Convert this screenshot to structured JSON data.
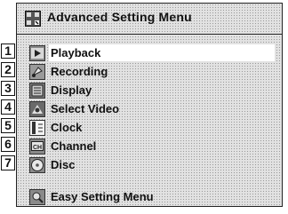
{
  "menu": {
    "title": "Advanced Setting Menu",
    "title_icon": "settings-grid-icon",
    "items": [
      {
        "number": "1",
        "label": "Playback",
        "icon": "playback-icon",
        "selected": true
      },
      {
        "number": "2",
        "label": "Recording",
        "icon": "recording-icon",
        "selected": false
      },
      {
        "number": "3",
        "label": "Display",
        "icon": "display-icon",
        "selected": false
      },
      {
        "number": "4",
        "label": "Select Video",
        "icon": "select-video-icon",
        "selected": false
      },
      {
        "number": "5",
        "label": "Clock",
        "icon": "clock-icon",
        "selected": false
      },
      {
        "number": "6",
        "label": "Channel",
        "icon": "channel-icon",
        "selected": false
      },
      {
        "number": "7",
        "label": "Disc",
        "icon": "disc-icon",
        "selected": false
      }
    ],
    "footer_item": {
      "label": "Easy Setting Menu",
      "icon": "easy-setting-icon"
    }
  },
  "colors": {
    "background": "#e2e2e2",
    "highlight": "#ffffff",
    "text": "#111111"
  }
}
